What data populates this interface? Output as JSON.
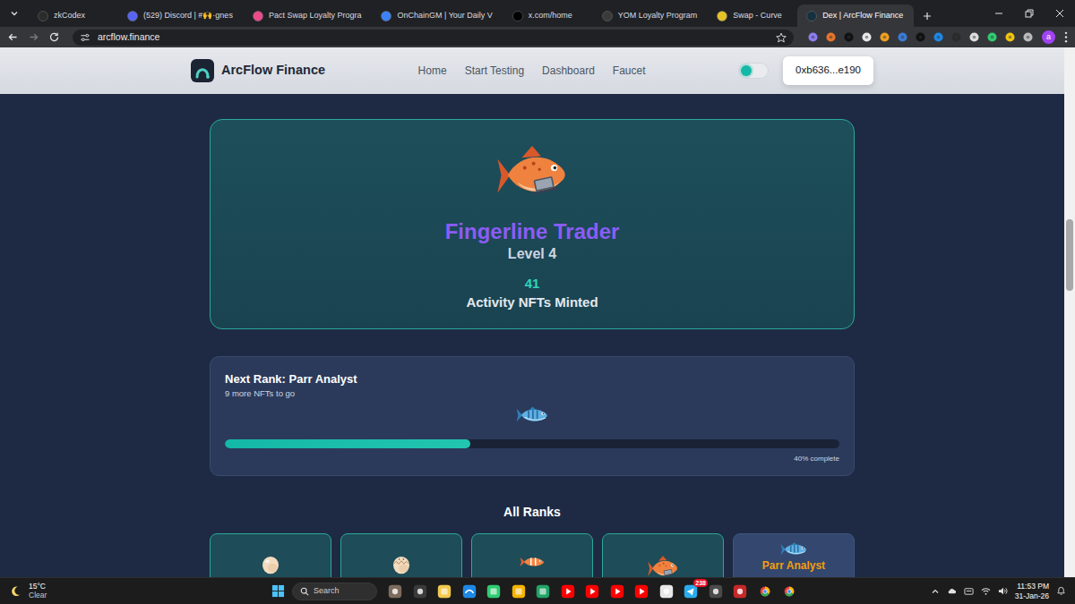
{
  "browser": {
    "tabs": [
      {
        "label": "zkCodex",
        "selected": false
      },
      {
        "label": "(529) Discord | #🙌·gnes",
        "selected": false
      },
      {
        "label": "Pact Swap Loyalty Progra",
        "selected": false
      },
      {
        "label": "OnChainGM | Your Daily V",
        "selected": false
      },
      {
        "label": "x.com/home",
        "selected": false
      },
      {
        "label": "YOM Loyalty Program",
        "selected": false
      },
      {
        "label": "Swap - Curve",
        "selected": false
      },
      {
        "label": "Dex | ArcFlow Finance",
        "selected": true
      }
    ],
    "url": "arcflow.finance",
    "bookmarked": false,
    "profile": "a"
  },
  "site": {
    "brand": "ArcFlow Finance",
    "nav": [
      {
        "label": "Home"
      },
      {
        "label": "Start Testing"
      },
      {
        "label": "Dashboard"
      },
      {
        "label": "Faucet"
      }
    ],
    "theme_toggle": {
      "on": false
    },
    "wallet": "0xb636...e190"
  },
  "current_rank": {
    "title": "Fingerline Trader",
    "level": "Level 4",
    "count": "41",
    "count_label": "Activity NFTs Minted"
  },
  "next_rank": {
    "title": "Next Rank: Parr Analyst",
    "remaining": "9 more NFTs to go",
    "level": 0.4,
    "reading": "40% complete"
  },
  "all_ranks": {
    "heading": "All Ranks",
    "items": [
      {
        "kind": "egg",
        "unlocked": true
      },
      {
        "kind": "hatchling",
        "unlocked": true
      },
      {
        "kind": "fry",
        "unlocked": true
      },
      {
        "kind": "trout",
        "unlocked": true
      },
      {
        "kind": "parr",
        "unlocked": false,
        "label": "Parr Analyst"
      }
    ]
  },
  "taskbar": {
    "weather": {
      "temp": "15°C",
      "condition": "Clear"
    },
    "search": {
      "placeholder": "Search"
    },
    "badge": "238",
    "time": "11:53 PM",
    "date": "31-Jan-26"
  }
}
